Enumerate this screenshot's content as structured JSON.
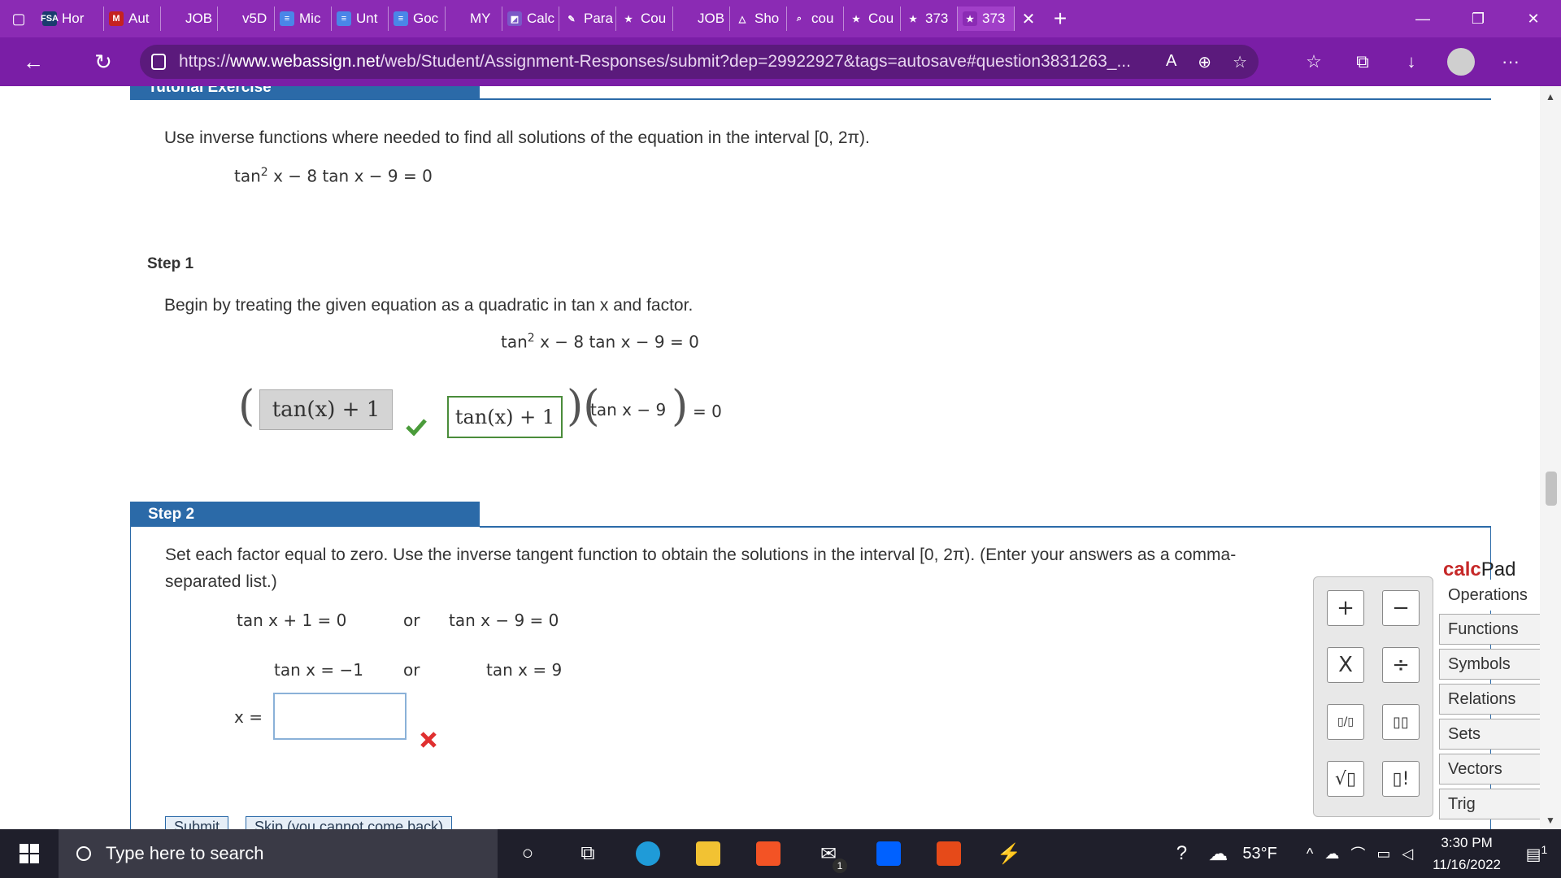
{
  "browser": {
    "tabs": [
      {
        "label": "Hor",
        "fav": "FSA",
        "color": "#1a3c6e"
      },
      {
        "label": "Aut",
        "fav": "M",
        "color": "#c5221f"
      },
      {
        "label": "JOB",
        "fav": "",
        "color": "#8b2bb4"
      },
      {
        "label": "v5D",
        "fav": "",
        "color": "#8b2bb4"
      },
      {
        "label": "Mic",
        "fav": "≡",
        "color": "#4a86e8"
      },
      {
        "label": "Unt",
        "fav": "≡",
        "color": "#4a86e8"
      },
      {
        "label": "Goc",
        "fav": "≡",
        "color": "#4a86e8"
      },
      {
        "label": "MY",
        "fav": "",
        "color": "#8b2bb4"
      },
      {
        "label": "Calc",
        "fav": "◩",
        "color": "#7b58c7"
      },
      {
        "label": "Para",
        "fav": "✎",
        "color": "#8b2bb4"
      },
      {
        "label": "Cou",
        "fav": "★",
        "color": "#8b2bb4"
      },
      {
        "label": "JOB",
        "fav": "",
        "color": "#8b2bb4"
      },
      {
        "label": "Sho",
        "fav": "△",
        "color": "#8b2bb4"
      },
      {
        "label": "cou",
        "fav": "⌕",
        "color": "#8b2bb4"
      },
      {
        "label": "Cou",
        "fav": "★",
        "color": "#8b2bb4"
      },
      {
        "label": "373",
        "fav": "★",
        "color": "#8b2bb4"
      },
      {
        "label": "373",
        "fav": "★",
        "color": "#8b2bb4"
      }
    ],
    "active_tab_close": "✕",
    "new_tab": "+",
    "url_prefix": "https://",
    "url_host": "www.webassign.net",
    "url_path": "/web/Student/Assignment-Responses/submit?dep=29922927&tags=autosave#question3831263_..."
  },
  "tutorial": {
    "header": "Tutorial Exercise",
    "instruction": "Use inverse functions where needed to find all solutions of the equation in the interval [0, 2π).",
    "equation_pre": "tan",
    "equation_sup": "2",
    "equation_post": "x − 8 tan x − 9 = 0"
  },
  "step1": {
    "title": "Step 1",
    "instruction": "Begin by treating the given equation as a quadratic in tan x and factor.",
    "equation_pre": "tan",
    "equation_sup": "2",
    "equation_post": "x − 8 tan x − 9 = 0",
    "given_factor": "tan(x) + 1",
    "answer_factor": "tan(x) + 1",
    "second_factor": "tan x − 9",
    "equals_zero": "= 0",
    "check_icon_color": "#4a9b3a"
  },
  "step2": {
    "header": "Step 2",
    "instruction_line1": "Set each factor equal to zero. Use the inverse tangent function to obtain the solutions in the interval [0, 2π). (Enter your answers as a comma-",
    "instruction_line2": "separated list.)",
    "eq_a1": "tan x + 1 = 0",
    "or1": "or",
    "eq_b1": "tan x − 9 = 0",
    "eq_a2": "tan x = −1",
    "or2": "or",
    "eq_b2": "tan x = 9",
    "x_label": "x =",
    "x_value": "",
    "error_color": "#e03030",
    "submit_label": "Submit",
    "skip_label": "Skip (you cannot come back)"
  },
  "calcpad": {
    "title_calc": "calc",
    "title_pad": "Pad",
    "tabs": [
      "Operations",
      "Functions",
      "Symbols",
      "Relations",
      "Sets",
      "Vectors",
      "Trig"
    ],
    "keys": [
      "+",
      "−",
      "X",
      "÷",
      "▯/▯",
      "▯▯",
      "√▯",
      "▯!"
    ]
  },
  "taskbar": {
    "search_placeholder": "Type here to search",
    "temperature": "53°F",
    "time": "3:30 PM",
    "date": "11/16/2022",
    "mail_badge": "1",
    "notif_badge": "1"
  }
}
